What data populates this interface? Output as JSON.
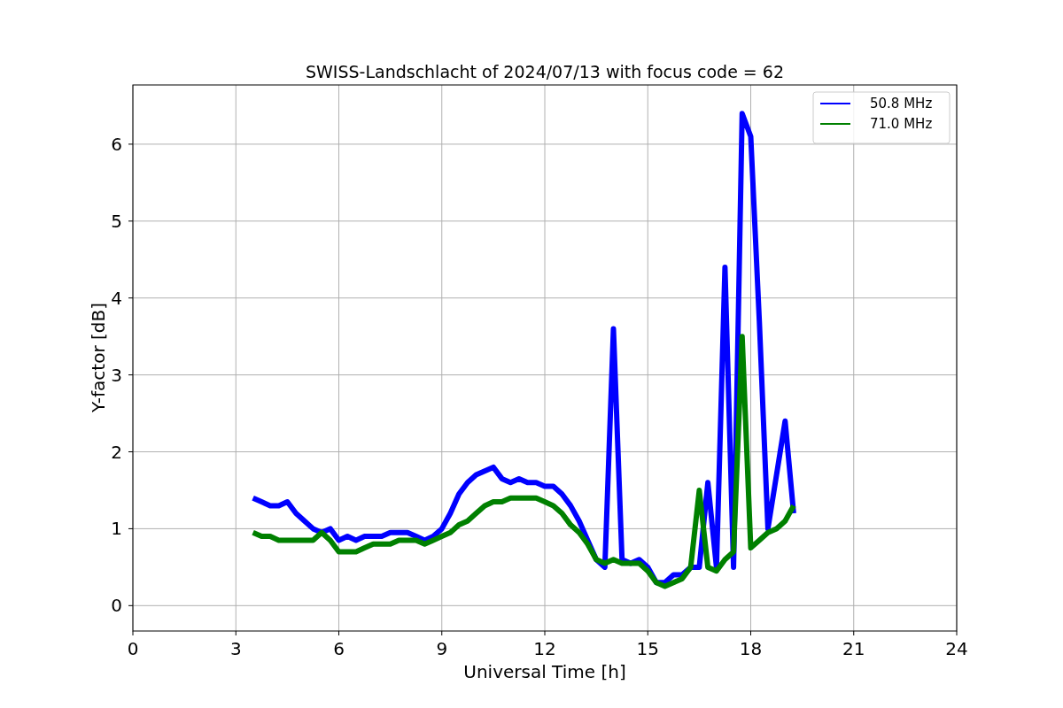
{
  "chart_data": {
    "type": "line",
    "title": "SWISS-Landschlacht of 2024/07/13 with focus code = 62",
    "xlabel": "Universal Time [h]",
    "ylabel": "Y-factor [dB]",
    "x": [
      3.5,
      3.75,
      4,
      4.25,
      4.5,
      4.75,
      5,
      5.25,
      5.5,
      5.75,
      6,
      6.25,
      6.5,
      6.75,
      7,
      7.25,
      7.5,
      7.75,
      8,
      8.25,
      8.5,
      8.75,
      9,
      9.25,
      9.5,
      9.75,
      10,
      10.25,
      10.5,
      10.75,
      11,
      11.25,
      11.5,
      11.75,
      12,
      12.25,
      12.5,
      12.75,
      13,
      13.25,
      13.5,
      13.75,
      14,
      14.25,
      14.5,
      14.75,
      15,
      15.25,
      15.5,
      15.75,
      16,
      16.25,
      16.5,
      16.75,
      17,
      17.25,
      17.5,
      17.75,
      18,
      18.25,
      18.5,
      18.75,
      19,
      19.25
    ],
    "series": [
      {
        "name": "50.8 MHz",
        "color": "#0000ff",
        "values": [
          1.4,
          1.35,
          1.3,
          1.3,
          1.35,
          1.2,
          1.1,
          1.0,
          0.95,
          1.0,
          0.85,
          0.9,
          0.85,
          0.9,
          0.9,
          0.9,
          0.95,
          0.95,
          0.95,
          0.9,
          0.85,
          0.9,
          1.0,
          1.2,
          1.45,
          1.6,
          1.7,
          1.75,
          1.8,
          1.65,
          1.6,
          1.65,
          1.6,
          1.6,
          1.55,
          1.55,
          1.45,
          1.3,
          1.1,
          0.85,
          0.6,
          0.5,
          3.6,
          0.6,
          0.55,
          0.6,
          0.5,
          0.3,
          0.3,
          0.4,
          0.4,
          0.5,
          0.5,
          1.6,
          0.5,
          4.4,
          0.5,
          6.4,
          6.1,
          3.7,
          1.0,
          1.7,
          2.4,
          1.2
        ]
      },
      {
        "name": "71.0 MHz",
        "color": "#008000",
        "values": [
          0.95,
          0.9,
          0.9,
          0.85,
          0.85,
          0.85,
          0.85,
          0.85,
          0.95,
          0.85,
          0.7,
          0.7,
          0.7,
          0.75,
          0.8,
          0.8,
          0.8,
          0.85,
          0.85,
          0.85,
          0.8,
          0.85,
          0.9,
          0.95,
          1.05,
          1.1,
          1.2,
          1.3,
          1.35,
          1.35,
          1.4,
          1.4,
          1.4,
          1.4,
          1.35,
          1.3,
          1.2,
          1.05,
          0.95,
          0.8,
          0.6,
          0.55,
          0.6,
          0.55,
          0.55,
          0.55,
          0.45,
          0.3,
          0.25,
          0.3,
          0.35,
          0.5,
          1.5,
          0.5,
          0.45,
          0.6,
          0.7,
          3.5,
          0.75,
          0.85,
          0.95,
          1.0,
          1.1,
          1.3
        ]
      }
    ],
    "xlim": [
      0,
      24
    ],
    "ylim": [
      -0.33,
      6.77
    ],
    "xticks": [
      0,
      3,
      6,
      9,
      12,
      15,
      18,
      21,
      24
    ],
    "yticks": [
      0,
      1,
      2,
      3,
      4,
      5,
      6
    ],
    "grid": true,
    "legend": true
  }
}
